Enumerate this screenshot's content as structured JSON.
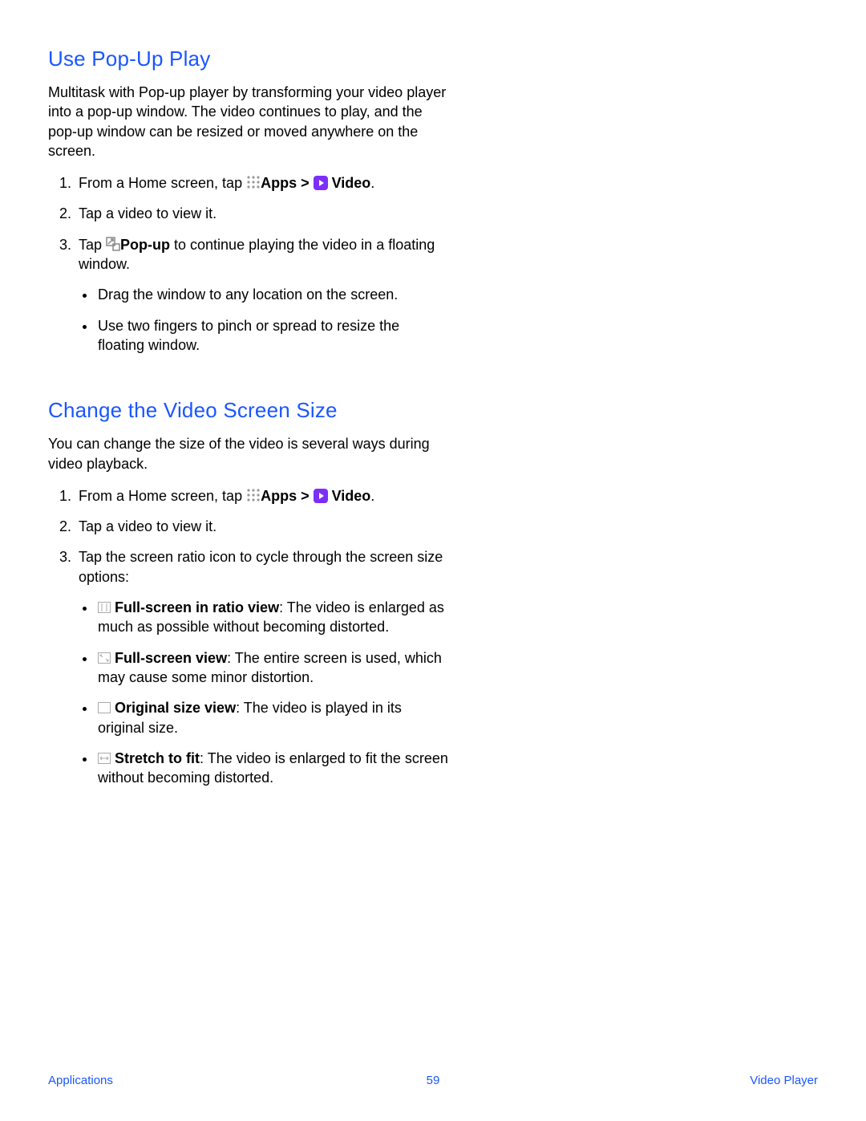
{
  "section1": {
    "heading": "Use Pop-Up Play",
    "intro": "Multitask with Pop-up player by transforming your video player into a pop-up window. The video continues to play, and the pop-up window can be resized or moved anywhere on the screen.",
    "step1_pre": "From a Home screen, tap ",
    "apps_label": "Apps",
    "gt": " > ",
    "video_label": "Video",
    "period": ".",
    "step2": "Tap a video to view it.",
    "step3_pre": "Tap ",
    "popup_label": "Pop-up",
    "step3_post": " to continue playing the video in a floating window.",
    "bullet1": "Drag the window to any location on the screen.",
    "bullet2": "Use two fingers to pinch or spread to resize the floating window."
  },
  "section2": {
    "heading": "Change the Video Screen Size",
    "intro": "You can change the size of the video is several ways during video playback.",
    "step1_pre": "From a Home screen, tap ",
    "apps_label": "Apps",
    "gt": " > ",
    "video_label": "Video",
    "period": ".",
    "step2": "Tap a video to view it.",
    "step3": "Tap the screen ratio icon to cycle through the screen size options:",
    "b1_label": "Full-screen in ratio view",
    "b1_text": ": The video is enlarged as much as possible without becoming distorted.",
    "b2_label": "Full-screen view",
    "b2_text": ": The entire screen is used, which may cause some minor distortion.",
    "b3_label": "Original size view",
    "b3_text": ": The video is played in its original size.",
    "b4_label": "Stretch to fit",
    "b4_text": ": The video is enlarged to fit the screen without becoming distorted."
  },
  "footer": {
    "left": "Applications",
    "page": "59",
    "right": "Video Player"
  }
}
